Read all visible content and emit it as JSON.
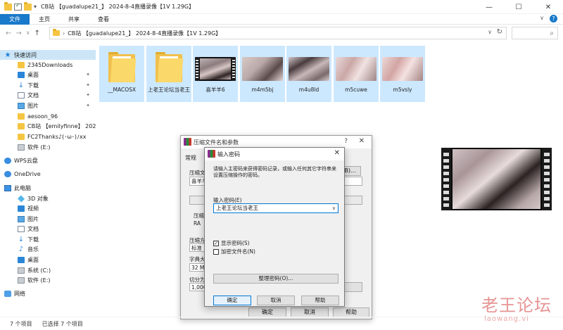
{
  "window": {
    "title": "CB站 【guadalupe21_】 2024-8-4直播录像【1V 1.29G】",
    "min": "—",
    "max": "☐",
    "close": "✕"
  },
  "ribbon": {
    "tabs": [
      "文件",
      "主页",
      "共享",
      "查看"
    ],
    "expand": "∨",
    "help": "?"
  },
  "nav": {
    "back": "←",
    "forward": "→",
    "recent": "∨",
    "up": "↑",
    "path_sep": "›",
    "path": "CB站 【guadalupe21_】 2024-8-4直播录像【1V 1.29G】",
    "dropdown": "∨",
    "refresh": "↻",
    "search_icon": "⌕"
  },
  "sidebar": {
    "items": [
      {
        "label": "快速访问",
        "icon": "star-icon"
      },
      {
        "label": "2345Downloads",
        "icon": "folder-icon"
      },
      {
        "label": "桌面",
        "icon": "desktop-icon"
      },
      {
        "label": "下载",
        "icon": "download-icon"
      },
      {
        "label": "文档",
        "icon": "document-icon"
      },
      {
        "label": "图片",
        "icon": "picture-icon"
      },
      {
        "label": "aesoon_96",
        "icon": "folder-icon"
      },
      {
        "label": "CB站 【emilyfinne】 2024-8",
        "icon": "folder-icon"
      },
      {
        "label": "FC2Thanks♪(･ω･)ﾉxx",
        "icon": "folder-icon"
      },
      {
        "label": "软件 (E:)",
        "icon": "drive-icon"
      },
      {
        "label": "WPS云盘",
        "icon": "cloud-icon"
      },
      {
        "label": "OneDrive",
        "icon": "cloud-icon"
      },
      {
        "label": "此电脑",
        "icon": "pc-icon"
      },
      {
        "label": "3D 对象",
        "icon": "cube-icon"
      },
      {
        "label": "视频",
        "icon": "video-icon"
      },
      {
        "label": "图片",
        "icon": "picture-icon"
      },
      {
        "label": "文档",
        "icon": "document-icon"
      },
      {
        "label": "下载",
        "icon": "download-icon"
      },
      {
        "label": "音乐",
        "icon": "music-icon"
      },
      {
        "label": "桌面",
        "icon": "desktop-icon"
      },
      {
        "label": "系统 (C:)",
        "icon": "drive-icon"
      },
      {
        "label": "软件 (E:)",
        "icon": "drive-icon"
      },
      {
        "label": "网络",
        "icon": "network-icon"
      }
    ],
    "pin_glyph": "📌"
  },
  "files": [
    {
      "name": "__MACOSX",
      "type": "folder"
    },
    {
      "name": "上老王论坛当老王",
      "type": "folder"
    },
    {
      "name": "喜羊羊6",
      "type": "video"
    },
    {
      "name": "m4m5bj",
      "type": "video"
    },
    {
      "name": "m4u8ld",
      "type": "video"
    },
    {
      "name": "m5cuwe",
      "type": "video"
    },
    {
      "name": "m5vsly",
      "type": "video"
    }
  ],
  "status": {
    "count": "7 个项目",
    "selected": "已选择 7 个项目"
  },
  "archive_dialog": {
    "title": "压缩文件名和参数",
    "help": "?",
    "close": "✕",
    "tab_general": "常规",
    "label_name": "压缩文",
    "name_value": "喜羊羊",
    "browse": "(B)...",
    "label_format": "压缩",
    "format_value": "RA",
    "label_method": "压缩方",
    "method_value": "标准",
    "label_dict": "字典大",
    "dict_value": "32 MB",
    "label_split": "切分为",
    "split_value": "1,000",
    "ok": "确定",
    "cancel": "取消",
    "help_btn": "帮助"
  },
  "password_dialog": {
    "title": "输入密码",
    "close": "✕",
    "info": "请输入主密码来获得密码记录，或输入任何其它字符串来设置压缩操作的密码。",
    "label_password": "输入密码(E)",
    "password_value": "上老王论坛当老王",
    "show_password": "显示密码(S)",
    "show_password_checked": true,
    "encrypt_names": "加密文件名(N)",
    "encrypt_names_checked": false,
    "organize": "整理密码(O)...",
    "ok": "确定",
    "cancel": "取消",
    "help": "帮助"
  },
  "watermark": {
    "text": "老王论坛",
    "url": "laowang.vi"
  }
}
